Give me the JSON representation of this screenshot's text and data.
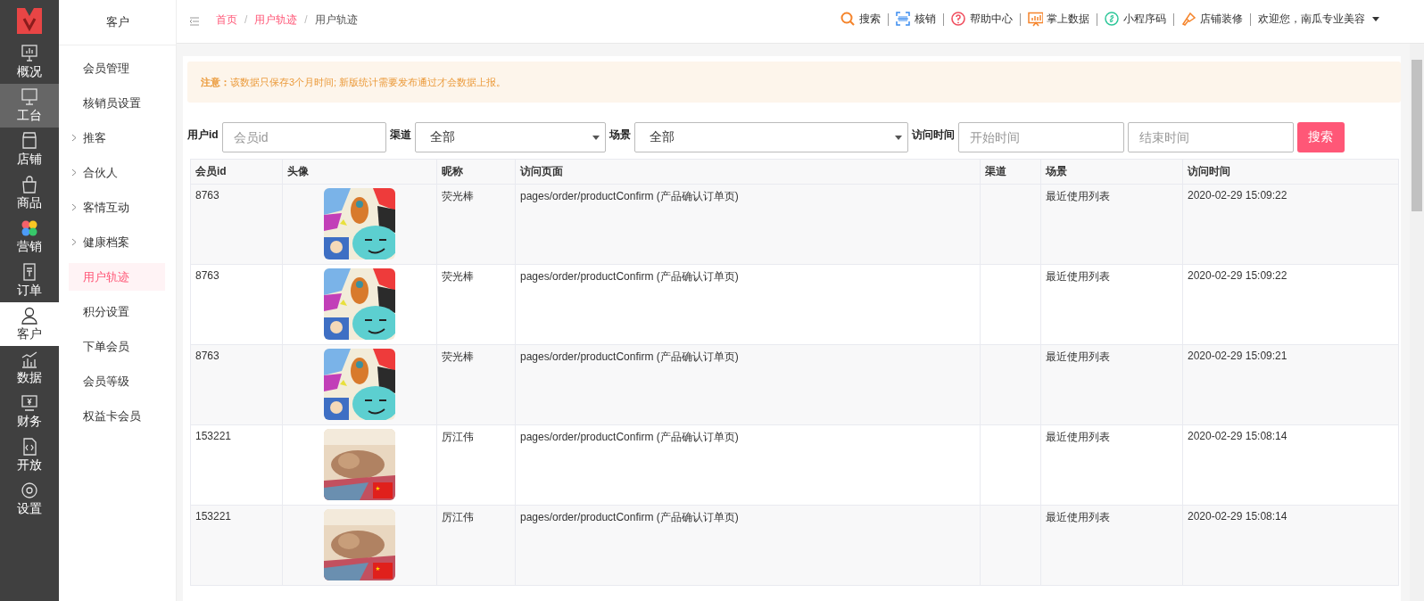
{
  "nav": [
    {
      "label": "概况",
      "kind": "overview",
      "selected": false,
      "hovered": false
    },
    {
      "label": "工台",
      "kind": "desk",
      "selected": false,
      "hovered": true
    },
    {
      "label": "店铺",
      "kind": "shop",
      "selected": false,
      "hovered": false
    },
    {
      "label": "商品",
      "kind": "goods",
      "selected": false,
      "hovered": false
    },
    {
      "label": "营销",
      "kind": "marketing",
      "selected": false,
      "hovered": false
    },
    {
      "label": "订单",
      "kind": "order",
      "selected": false,
      "hovered": false
    },
    {
      "label": "客户",
      "kind": "customer",
      "selected": true,
      "hovered": false
    },
    {
      "label": "数据",
      "kind": "data",
      "selected": false,
      "hovered": false
    },
    {
      "label": "财务",
      "kind": "finance",
      "selected": false,
      "hovered": false
    },
    {
      "label": "开放",
      "kind": "open",
      "selected": false,
      "hovered": false
    },
    {
      "label": "设置",
      "kind": "settings",
      "selected": false,
      "hovered": false
    }
  ],
  "subnav": {
    "title": "客户",
    "items": [
      {
        "label": "会员管理",
        "expandable": false,
        "selected": false
      },
      {
        "label": "核销员设置",
        "expandable": false,
        "selected": false
      },
      {
        "label": "推客",
        "expandable": true,
        "selected": false
      },
      {
        "label": "合伙人",
        "expandable": true,
        "selected": false
      },
      {
        "label": "客情互动",
        "expandable": true,
        "selected": false
      },
      {
        "label": "健康档案",
        "expandable": true,
        "selected": false
      },
      {
        "label": "用户轨迹",
        "expandable": false,
        "selected": true
      },
      {
        "label": "积分设置",
        "expandable": false,
        "selected": false
      },
      {
        "label": "下单会员",
        "expandable": false,
        "selected": false
      },
      {
        "label": "会员等级",
        "expandable": false,
        "selected": false
      },
      {
        "label": "权益卡会员",
        "expandable": false,
        "selected": false
      }
    ]
  },
  "breadcrumb": [
    {
      "label": "首页",
      "kind": "link"
    },
    {
      "label": "/",
      "kind": "separator"
    },
    {
      "label": "用户轨迹",
      "kind": "link"
    },
    {
      "label": "/",
      "kind": "separator"
    },
    {
      "label": "用户轨迹",
      "kind": "current"
    }
  ],
  "toolbar": [
    {
      "label": "搜索",
      "kind": "search"
    },
    {
      "label": "核销",
      "kind": "scan"
    },
    {
      "label": "帮助中心",
      "kind": "help"
    },
    {
      "label": "掌上数据",
      "kind": "chart"
    },
    {
      "label": "小程序码",
      "kind": "link"
    },
    {
      "label": "店铺装修",
      "kind": "brush"
    }
  ],
  "user": "欢迎您，南瓜专业美容",
  "notice": {
    "label": "注意：",
    "text": "该数据只保存3个月时间; 新版统计需要发布通过才会数据上报。"
  },
  "filters": [
    {
      "label": "用户id",
      "kind": "input",
      "fields": [
        {
          "placeholder": "会员id"
        }
      ]
    },
    {
      "label": "渠道",
      "kind": "select",
      "value": "全部"
    },
    {
      "label": "场景",
      "kind": "select",
      "value": "全部"
    },
    {
      "label": "访问时间",
      "kind": "input",
      "fields": [
        {
          "placeholder": "开始时间"
        },
        {
          "placeholder": "结束时间"
        }
      ]
    }
  ],
  "search_button": "搜索",
  "table": {
    "columns": [
      "会员id",
      "头像",
      "昵称",
      "访问页面",
      "渠道",
      "场景",
      "访问时间"
    ],
    "rows": [
      {
        "member_id": "8763",
        "nickname": "荧光棒",
        "page": "pages/order/productConfirm (产品确认订单页)",
        "scene": "最近使用列表",
        "time": "2020-02-29 15:09:22"
      },
      {
        "member_id": "8763",
        "nickname": "荧光棒",
        "page": "pages/order/productConfirm (产品确认订单页)",
        "scene": "最近使用列表",
        "time": "2020-02-29 15:09:22"
      },
      {
        "member_id": "8763",
        "nickname": "荧光棒",
        "page": "pages/order/productConfirm (产品确认订单页)",
        "scene": "最近使用列表",
        "time": "2020-02-29 15:09:21"
      },
      {
        "member_id": "153221",
        "nickname": "厉江伟",
        "page": "pages/order/productConfirm (产品确认订单页)",
        "scene": "最近使用列表",
        "time": "2020-02-29 15:08:14"
      },
      {
        "member_id": "153221",
        "nickname": "厉江伟",
        "page": "pages/order/productConfirm (产品确认订单页)",
        "scene": "最近使用列表",
        "time": "2020-02-29 15:08:14"
      }
    ]
  }
}
